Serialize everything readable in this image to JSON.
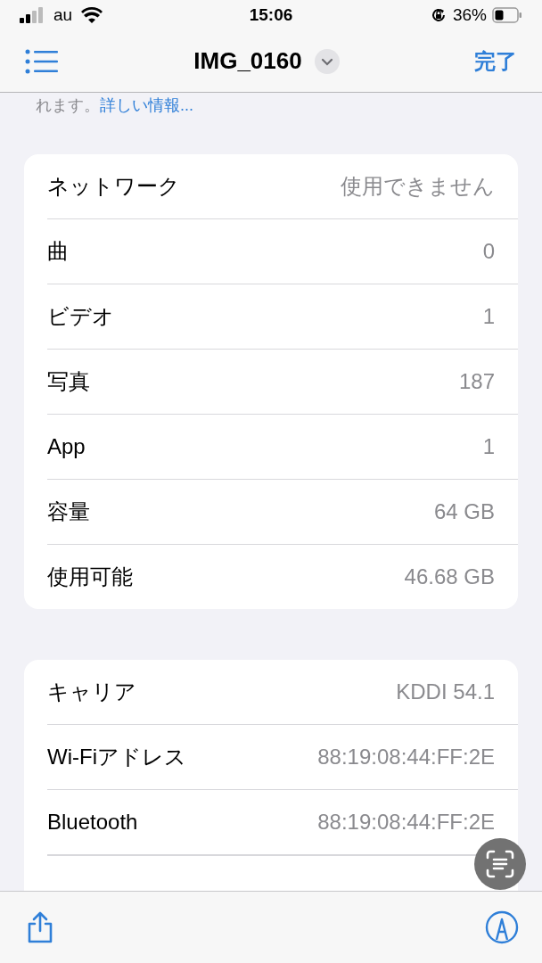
{
  "status_bar": {
    "carrier": "au",
    "time": "15:06",
    "battery": "36%"
  },
  "nav_bar": {
    "title": "IMG_0160",
    "done": "完了"
  },
  "footnote": {
    "text": "れます。",
    "link": "詳しい情報..."
  },
  "sections": [
    {
      "rows": [
        {
          "label": "ネットワーク",
          "value": "使用できません"
        },
        {
          "label": "曲",
          "value": "0"
        },
        {
          "label": "ビデオ",
          "value": "1"
        },
        {
          "label": "写真",
          "value": "187"
        },
        {
          "label": "App",
          "value": "1"
        },
        {
          "label": "容量",
          "value": "64 GB"
        },
        {
          "label": "使用可能",
          "value": "46.68 GB"
        }
      ]
    },
    {
      "rows": [
        {
          "label": "キャリア",
          "value": "KDDI 54.1"
        },
        {
          "label": "Wi-Fiアドレス",
          "value": "88:19:08:44:FF:2E"
        },
        {
          "label": "Bluetooth",
          "value": "88:19:08:44:FF:2E"
        }
      ]
    }
  ]
}
